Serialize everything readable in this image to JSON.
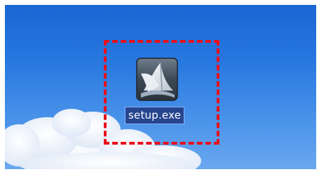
{
  "desktop": {
    "icon": {
      "icon_name": "setup-installer-icon",
      "label": "setup.exe"
    }
  },
  "colors": {
    "desktop_sky": "#2878e0",
    "selection_frame": "#e8101a",
    "label_highlight": "#26458f"
  }
}
